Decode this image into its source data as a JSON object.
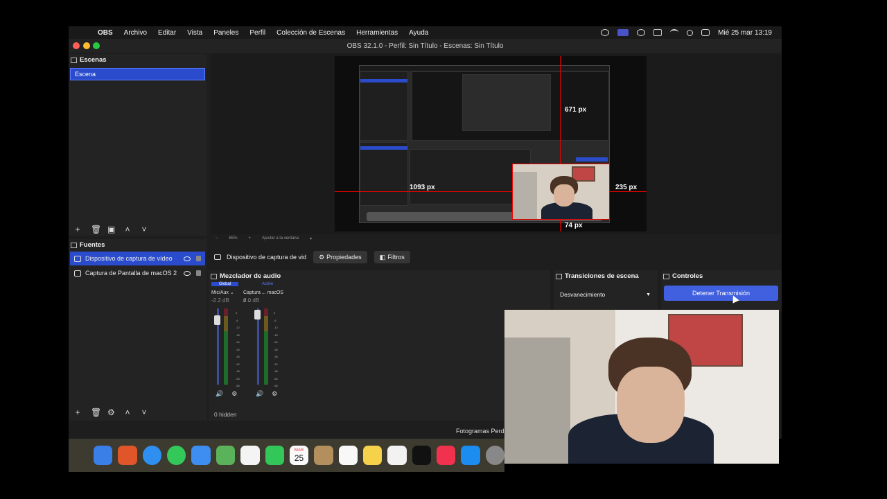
{
  "menubar": {
    "items": [
      "OBS",
      "Archivo",
      "Editar",
      "Vista",
      "Paneles",
      "Perfil",
      "Colección de Escenas",
      "Herramientas",
      "Ayuda"
    ],
    "clock": "Mié 25 mar  13:19"
  },
  "window": {
    "title": "OBS 32.1.0 - Perfil: Sin Título - Escenas: Sin Título"
  },
  "scenes": {
    "title": "Escenas",
    "items": [
      "Escena"
    ]
  },
  "sources": {
    "title": "Fuentes",
    "items": [
      "Dispositivo de captura de vídeo",
      "Captura de Pantalla de macOS 2"
    ]
  },
  "preview": {
    "measurements": {
      "top": "671 px",
      "left": "1093 px",
      "right": "235 px",
      "bottom": "74 px"
    },
    "zoom": "65%",
    "fit_label": "Ajustar a la ventana"
  },
  "source_toolbar": {
    "source_name": "Dispositivo de captura de vid",
    "properties": "Propiedades",
    "filters": "Filtros"
  },
  "mixer": {
    "title": "Mezclador de audio",
    "tabs": [
      "Global",
      "Active"
    ],
    "channels": [
      {
        "name": "Mic/Aux",
        "db": "-2.2 dB"
      },
      {
        "name": "Captura ... macOS 2",
        "db": "0.0 dB"
      }
    ],
    "hidden_count": "0 hidden"
  },
  "transitions": {
    "title": "Transiciones de escena",
    "selected": "Desvanecimiento"
  },
  "controls": {
    "title": "Controles",
    "stop_stream": "Detener Transmisión"
  },
  "statusbar": {
    "text": "Fotogramas Perdi"
  },
  "dock": {
    "calendar_month": "MAR",
    "calendar_day": "25",
    "apps": [
      "finder-icon",
      "launchpad-icon",
      "safari-icon",
      "messages-icon",
      "mail-icon",
      "maps-icon",
      "photos-icon",
      "facetime-icon",
      "calendar-icon",
      "contacts-icon",
      "reminders-icon",
      "notes-icon",
      "freeform-icon",
      "appletv-icon",
      "music-icon",
      "appstore-icon",
      "settings-icon"
    ]
  },
  "colors": {
    "accent": "#2a4ccc",
    "button": "#4160df",
    "guide": "#e00000"
  }
}
